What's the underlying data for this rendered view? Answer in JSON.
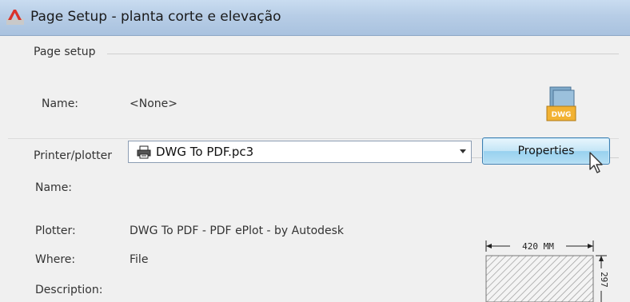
{
  "window": {
    "title": "Page Setup - planta corte e elevação"
  },
  "page_setup": {
    "group_label": "Page setup",
    "name_label": "Name:",
    "name_value": "<None>"
  },
  "printer": {
    "group_label": "Printer/plotter",
    "name_label": "Name:",
    "selected_printer": "DWG To PDF.pc3",
    "properties_button": "Properties",
    "plotter_label": "Plotter:",
    "plotter_value": "DWG To PDF - PDF ePlot - by Autodesk",
    "where_label": "Where:",
    "where_value": "File",
    "description_label": "Description:"
  },
  "preview": {
    "width_text": "420  MM",
    "height_text": "297"
  },
  "icons": [
    "autocad-app-icon",
    "dwg-file-icon",
    "printer-icon",
    "chevron-down-icon",
    "mouse-pointer-icon"
  ],
  "colors": {
    "titlebar": "#b7cde6",
    "button_border": "#3c7fb1",
    "accent_red": "#d9332c"
  }
}
